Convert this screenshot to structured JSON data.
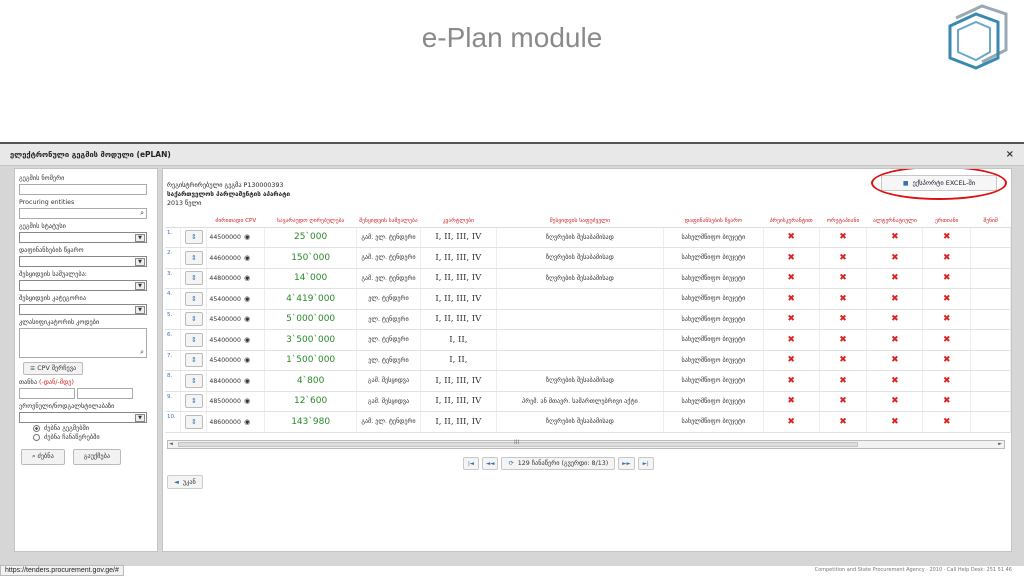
{
  "slide": {
    "title": "e-Plan module"
  },
  "app": {
    "title": "ელექტრონული გეგმის მოდული (ePLAN)",
    "close": "×"
  },
  "sidebar": {
    "plan_number_label": "გეგმის ნომერი",
    "procuring_entities_label": "Procuring entities",
    "plan_status_label": "გეგმის სტატუსი",
    "funding_source_label": "დაფინანსების წყარო",
    "purchase_object_label": "შესყიდვის საშუალება:",
    "purchase_category_label": "შესყიდვის კატეგორია",
    "classifier_code_label": "კლასიფიკატორის კოდები",
    "cpv_button": "CPV შერჩევა",
    "amount_label": "თანხა",
    "amount_hint": "(-დან/-მდე)",
    "status_label": "ეროვნული/ნოდგალსტილაბაზი",
    "radio_search_plans": "ძებნა გეგმებში",
    "radio_search_records": "ძებნა ჩანაწერებში",
    "search_button": "ძებნა",
    "reset_button": "გაუქმება"
  },
  "main": {
    "plan_registered": "რეგისტრირებული გეგმა P130000393",
    "entity_name": "საქართველოს პარლამენტის აპარატი",
    "year": "2013 წელი",
    "export_label": "ექსპორტი EXCEL-ში",
    "columns": [
      "",
      "",
      "ძირითადი CPV",
      "სავარაუდო ღირებულება",
      "შესყიდვის საშუალება",
      "კვარტლები",
      "შესყიდვის საფუძველი",
      "დაფინანსების წყარო",
      "პრეისკურანტით",
      "ორეტაპიანი",
      "ალტერნატიული",
      "ერთიანი",
      "შენიშ"
    ],
    "rows": [
      {
        "n": "1.",
        "cpv": "44500000",
        "amount": "25`000",
        "method": "გამ. ელ. ტენდერი",
        "quarters": "I, II, III, IV",
        "reason": "ზღვრების შესაბამისად",
        "fund": "სახელმწიფო ბიუჯეტი"
      },
      {
        "n": "2.",
        "cpv": "44600000",
        "amount": "150`000",
        "method": "გამ. ელ. ტენდერი",
        "quarters": "I, II, III, IV",
        "reason": "ზღვრების შესაბამისად",
        "fund": "სახელმწიფო ბიუჯეტი"
      },
      {
        "n": "3.",
        "cpv": "44800000",
        "amount": "14`000",
        "method": "გამ. ელ. ტენდერი",
        "quarters": "I, II, III, IV",
        "reason": "ზღვრების შესაბამისად",
        "fund": "სახელმწიფო ბიუჯეტი"
      },
      {
        "n": "4.",
        "cpv": "45400000",
        "amount": "4`419`000",
        "method": "ელ. ტენდერი",
        "quarters": "I, II, III, IV",
        "reason": "",
        "fund": "სახელმწიფო ბიუჯეტი"
      },
      {
        "n": "5.",
        "cpv": "45400000",
        "amount": "5`000`000",
        "method": "ელ. ტენდერი",
        "quarters": "I, II, III, IV",
        "reason": "",
        "fund": "სახელმწიფო ბიუჯეტი"
      },
      {
        "n": "6.",
        "cpv": "45400000",
        "amount": "3`500`000",
        "method": "ელ. ტენდერი",
        "quarters": "I, II,",
        "reason": "",
        "fund": "სახელმწიფო ბიუჯეტი"
      },
      {
        "n": "7.",
        "cpv": "45400000",
        "amount": "1`500`000",
        "method": "ელ. ტენდერი",
        "quarters": "I, II,",
        "reason": "",
        "fund": "სახელმწიფო ბიუჯეტი"
      },
      {
        "n": "8.",
        "cpv": "48400000",
        "amount": "4`800",
        "method": "გამ. შესყიდვა",
        "quarters": "I, II, III, IV",
        "reason": "ზღვრების შესაბამისად",
        "fund": "სახელმწიფო ბიუჯეტი"
      },
      {
        "n": "9.",
        "cpv": "48500000",
        "amount": "12`600",
        "method": "გამ. შესყიდვა",
        "quarters": "I, II, III, IV",
        "reason": "პრემ. ან მთავრ. სამართლებრივი აქტი",
        "fund": "სახელმწიფო ბიუჯეტი"
      },
      {
        "n": "10.",
        "cpv": "48600000",
        "amount": "143`980",
        "method": "გამ. ელ. ტენდერი",
        "quarters": "I, II, III, IV",
        "reason": "ზღვრების შესაბამისად",
        "fund": "სახელმწიფო ბიუჯეტი"
      }
    ],
    "scroll_mid": "III",
    "pager_info": "129 ჩანაწერი (გვერდი: 8/13)",
    "back_label": "უკან"
  },
  "footer": {
    "credit": "Competition and State Procurement Agency · 2010 · Call Help Desk: 251 51 46",
    "status_url": "https://tenders.procurement.gov.ge/#"
  },
  "colors": {
    "export_ring": "#dd1111",
    "amount_green": "#2a8a2a",
    "flag_red": "#d22222",
    "accent_blue": "#3a6fb0"
  }
}
